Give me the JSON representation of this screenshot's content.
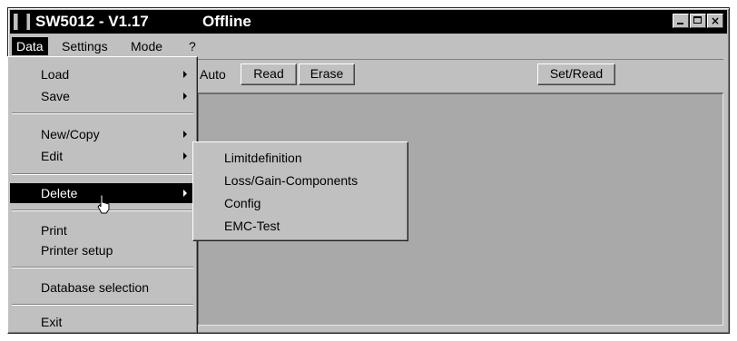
{
  "window": {
    "title": "SW5012 - V1.17",
    "status": "Offline",
    "icon": "app-grid-icon",
    "icon_text": [
      "██",
      "██",
      "██"
    ],
    "controls": {
      "minimize": "minimize-icon",
      "maximize": "maximize-icon",
      "close": "×"
    }
  },
  "menubar": {
    "items": [
      "Data",
      "Settings",
      "Mode",
      "?"
    ],
    "active": "Data"
  },
  "toolbar": {
    "auto_label": "Auto",
    "read_label": "Read",
    "erase_label": "Erase",
    "setread_label": "Set/Read"
  },
  "data_menu": {
    "items": [
      {
        "label": "Load",
        "has_submenu": true
      },
      {
        "label": "Save",
        "has_submenu": true
      },
      {
        "label": "New/Copy",
        "has_submenu": true
      },
      {
        "label": "Edit",
        "has_submenu": true
      },
      {
        "label": "Delete",
        "has_submenu": true,
        "highlighted": true
      },
      {
        "label": "Print",
        "has_submenu": false
      },
      {
        "label": "Printer setup",
        "has_submenu": false
      },
      {
        "label": "Database selection",
        "has_submenu": false
      },
      {
        "label": "Exit",
        "has_submenu": false
      }
    ]
  },
  "delete_submenu": {
    "items": [
      "Limitdefinition",
      "Loss/Gain-Components",
      "Config",
      "EMC-Test"
    ]
  },
  "colors": {
    "face": "#c0c0c0",
    "titlebar": "#000000",
    "highlight": "#000000",
    "workspace": "#a9a9a9"
  }
}
